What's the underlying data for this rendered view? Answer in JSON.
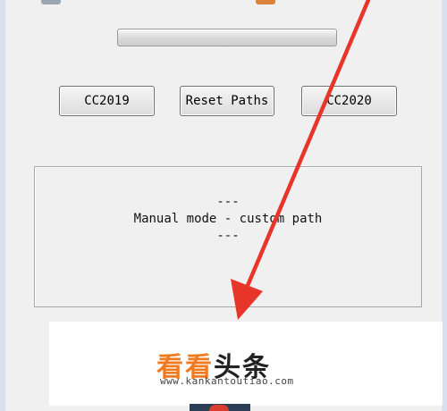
{
  "progress": {
    "value": 0
  },
  "buttons": {
    "cc2019": "CC2019",
    "reset_paths": "Reset Paths",
    "cc2020": "CC2020"
  },
  "status": {
    "line1": "---",
    "line2": "Manual mode - custom path",
    "line3": "---"
  },
  "watermark": {
    "brand_orange": "看看",
    "brand_dark": "头条",
    "url": "www.kankantoutiao.com"
  },
  "colors": {
    "annotation_arrow": "#e8352a",
    "brand_orange": "#f07a20"
  },
  "icons": {
    "arrow": "annotation-arrow"
  }
}
